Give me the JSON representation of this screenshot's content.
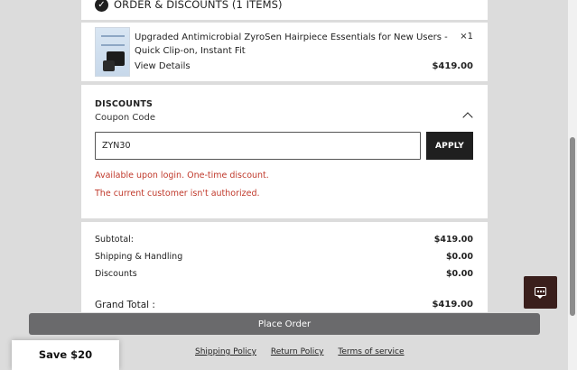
{
  "order_section": {
    "title": "ORDER & DISCOUNTS (1 ITEMS)"
  },
  "product": {
    "title": "Upgraded Antimicrobial ZyroSen Hairpiece Essentials for New Users - Quick Clip-on, Instant Fit",
    "quantity": "×1",
    "details_link": "View Details",
    "price": "$419.00"
  },
  "discounts": {
    "heading": "DISCOUNTS",
    "coupon_label": "Coupon Code",
    "coupon_value": "ZYN30",
    "apply_label": "APPLY",
    "error_1": "Available upon login. One-time discount.",
    "error_2": "The current customer isn't authorized."
  },
  "summary": {
    "subtotal_label": "Subtotal:",
    "subtotal_value": "$419.00",
    "shipping_label": "Shipping & Handling",
    "shipping_value": "$0.00",
    "discounts_label": "Discounts",
    "discounts_value": "$0.00",
    "grand_total_label": "Grand Total :",
    "grand_total_value": "$419.00"
  },
  "place_order_label": "Place Order",
  "footer_links": [
    "Shipping Policy",
    "Return Policy",
    "Terms of service"
  ],
  "save_banner": "Save $20",
  "icons": {
    "check": "check-icon",
    "chevron": "chevron-up-icon",
    "chat": "chat-icon"
  },
  "colors": {
    "error": "#c0392b",
    "button_dark": "#1f1f1f",
    "place_order": "#6a6a6c",
    "chat_bg": "#3a1f1c"
  }
}
